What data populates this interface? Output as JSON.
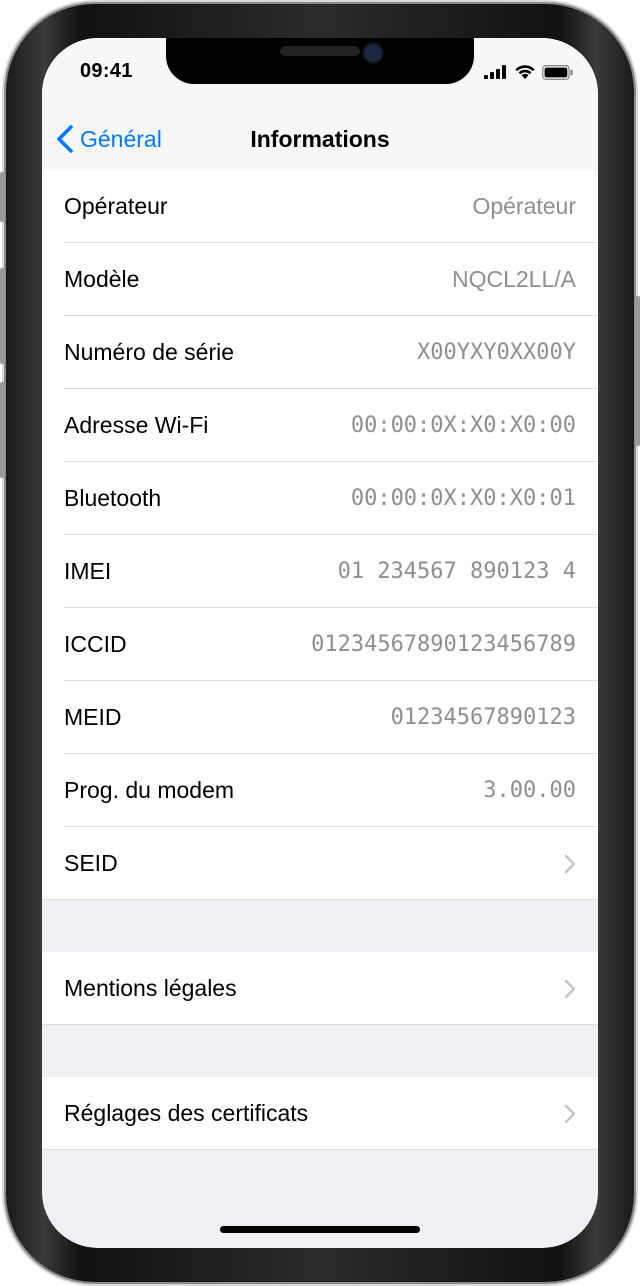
{
  "statusbar": {
    "time": "09:41"
  },
  "navbar": {
    "back_label": "Général",
    "title": "Informations"
  },
  "info_rows": [
    {
      "label": "Opérateur",
      "value": "Opérateur"
    },
    {
      "label": "Modèle",
      "value": "NQCL2LL/A"
    },
    {
      "label": "Numéro de série",
      "value": "X00YXY0XX00Y"
    },
    {
      "label": "Adresse Wi-Fi",
      "value": "00:00:0X:X0:X0:00"
    },
    {
      "label": "Bluetooth",
      "value": "00:00:0X:X0:X0:01"
    },
    {
      "label": "IMEI",
      "value": "01 234567 890123 4"
    },
    {
      "label": "ICCID",
      "value": "01234567890123456789"
    },
    {
      "label": "MEID",
      "value": "01234567890123"
    },
    {
      "label": "Prog. du modem",
      "value": "3.00.00"
    },
    {
      "label": "SEID",
      "icon": "chevron-right-icon"
    }
  ],
  "legal": {
    "label": "Mentions légales",
    "icon": "chevron-right-icon"
  },
  "certificates": {
    "label": "Réglages des certificats",
    "icon": "chevron-right-icon"
  },
  "colors": {
    "accent": "#007aff",
    "secondary_text": "#8e8e93",
    "background": "#efeff4"
  }
}
